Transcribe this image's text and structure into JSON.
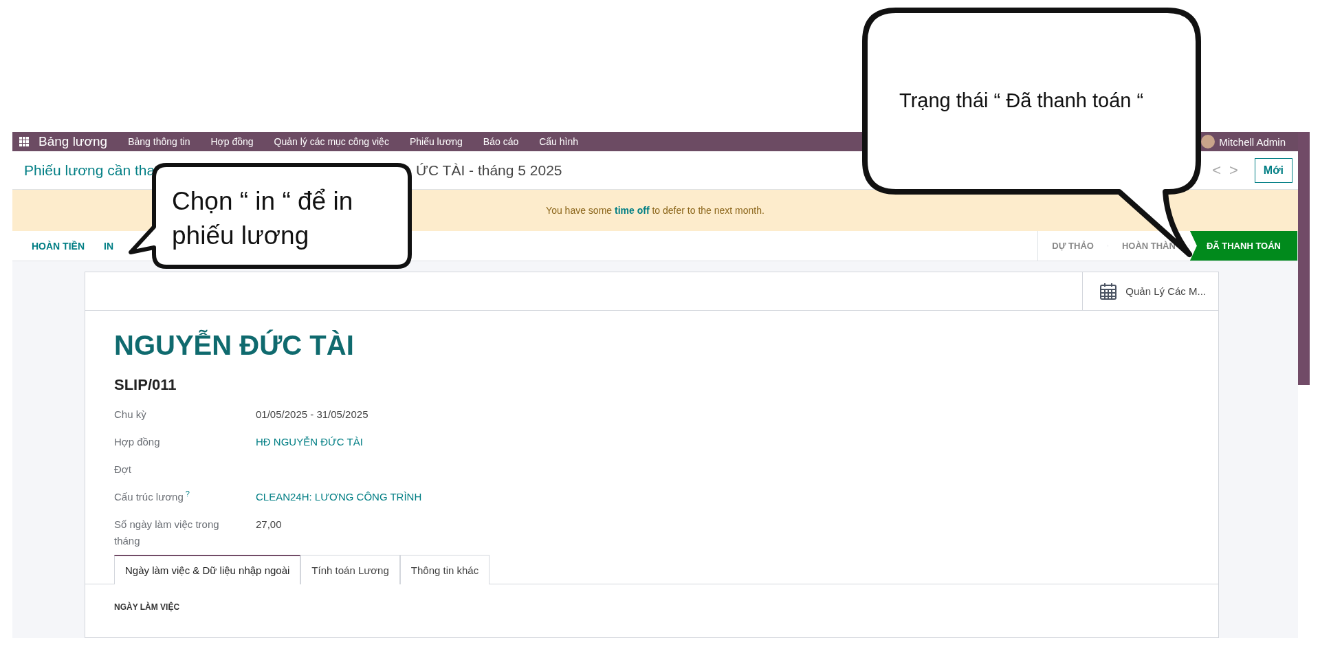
{
  "nav": {
    "app": "Bảng lương",
    "items": [
      "Bảng thông tin",
      "Hợp đồng",
      "Quản lý các mục công việc",
      "Phiếu lương",
      "Báo cáo",
      "Cấu hình"
    ],
    "user": "Mitchell Admin"
  },
  "breadcrumb": {
    "visible_start": "Phiếu lương cần tha",
    "visible_end": "ỨC TÀI - tháng 5 2025"
  },
  "pager": {
    "prev": "<",
    "next": ">"
  },
  "new_button": "Mới",
  "banner": "You have some **time off** to defer to the next month.",
  "actions": [
    "HOÀN TIỀN",
    "IN"
  ],
  "status_steps": [
    {
      "label": "DỰ THẢO",
      "selected": false
    },
    {
      "label": "HOÀN THÀN",
      "selected": false
    },
    {
      "label": "ĐÃ THANH TOÁN",
      "selected": true
    }
  ],
  "smart_button": "Quản Lý Các M...",
  "title": "NGUYỄN ĐỨC TÀI",
  "reference": "SLIP/011",
  "fields": [
    {
      "label": "Chu kỳ",
      "value": "01/05/2025 - 31/05/2025",
      "kind": "text"
    },
    {
      "label": "Hợp đồng",
      "value": "HĐ NGUYỄN ĐỨC TÀI",
      "kind": "link"
    },
    {
      "label": "Đợt"
    },
    {
      "label": "Cấu trúc lương",
      "help": "?",
      "value": "CLEAN24H: LƯƠNG CÔNG TRÌNH",
      "kind": "link"
    },
    {
      "label": "Số ngày làm việc trong tháng",
      "value": "27,00",
      "kind": "text"
    }
  ],
  "tabs": [
    {
      "label": "Ngày làm việc & Dữ liệu nhập ngoài",
      "selected": true
    },
    {
      "label": "Tính toán Lương",
      "selected": false
    },
    {
      "label": "Thông tin khác",
      "selected": false
    }
  ],
  "section_heading": "NGÀY LÀM VIỆC",
  "annotations": [
    {
      "text": "Chọn “ in “ để in phiếu lương"
    },
    {
      "text": "Trạng thái “ Đã thanh toán “"
    }
  ]
}
